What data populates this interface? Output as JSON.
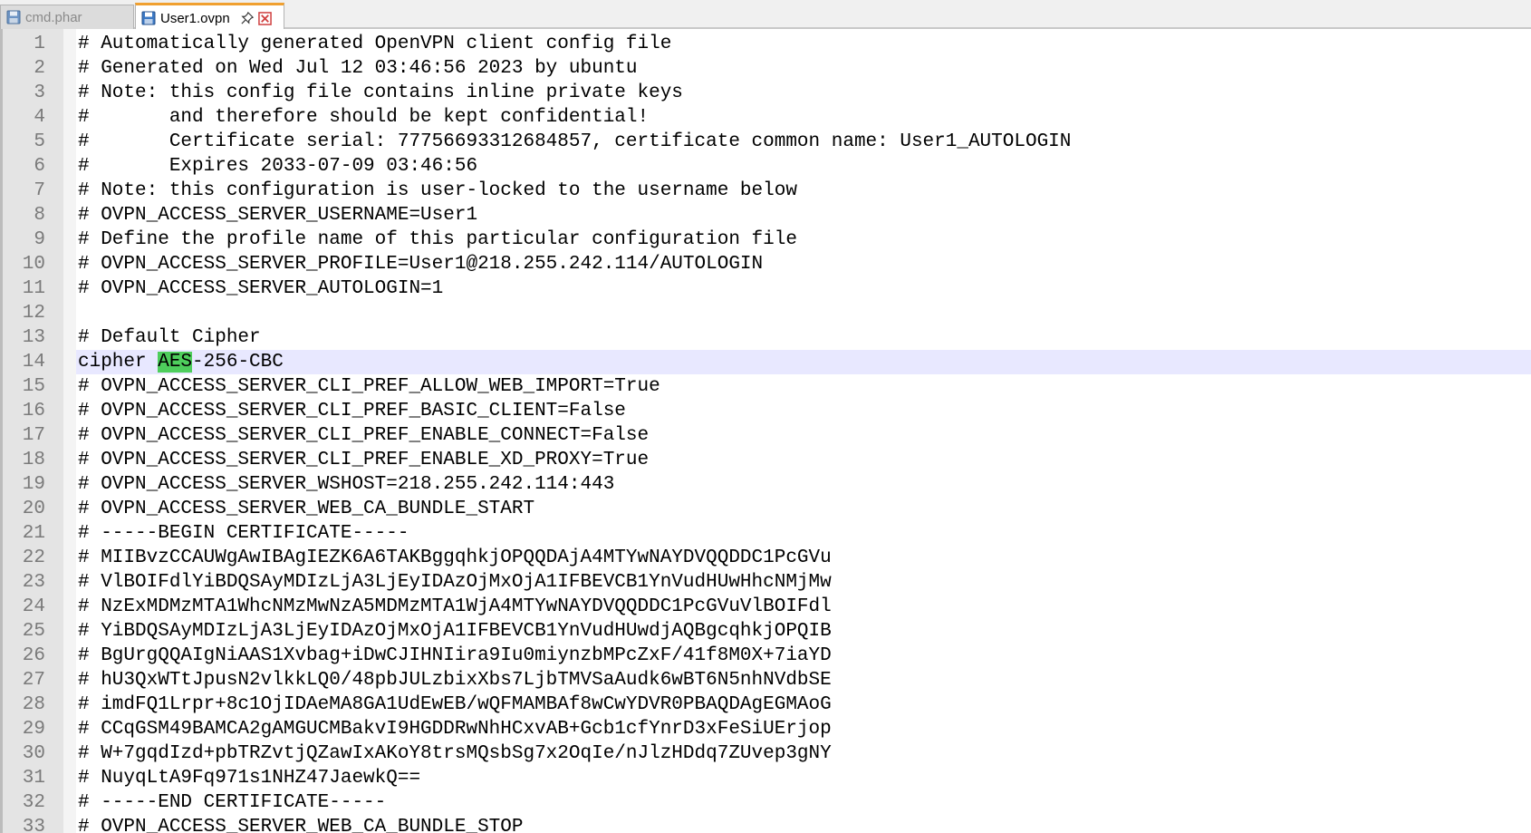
{
  "tabs": [
    {
      "label": "cmd.phar",
      "active": false
    },
    {
      "label": "User1.ovpn",
      "active": true
    }
  ],
  "icons": {
    "file": "save-disk-icon",
    "pin": "pin-icon",
    "close": "close-icon"
  },
  "colors": {
    "active_tab_accent": "#f0a030",
    "current_line": "#e8e8ff",
    "search_highlight": "#4ece5c",
    "close_icon": "#d04040"
  },
  "editor": {
    "current_line": 14,
    "highlight": {
      "line": 14,
      "text": "AES"
    },
    "lines": [
      {
        "n": "1",
        "text": "# Automatically generated OpenVPN client config file"
      },
      {
        "n": "2",
        "text": "# Generated on Wed Jul 12 03:46:56 2023 by ubuntu"
      },
      {
        "n": "3",
        "text": "# Note: this config file contains inline private keys"
      },
      {
        "n": "4",
        "text": "#       and therefore should be kept confidential!"
      },
      {
        "n": "5",
        "text": "#       Certificate serial: 77756693312684857, certificate common name: User1_AUTOLOGIN"
      },
      {
        "n": "6",
        "text": "#       Expires 2033-07-09 03:46:56"
      },
      {
        "n": "7",
        "text": "# Note: this configuration is user-locked to the username below"
      },
      {
        "n": "8",
        "text": "# OVPN_ACCESS_SERVER_USERNAME=User1"
      },
      {
        "n": "9",
        "text": "# Define the profile name of this particular configuration file"
      },
      {
        "n": "10",
        "text": "# OVPN_ACCESS_SERVER_PROFILE=User1@218.255.242.114/AUTOLOGIN"
      },
      {
        "n": "11",
        "text": "# OVPN_ACCESS_SERVER_AUTOLOGIN=1"
      },
      {
        "n": "12",
        "text": ""
      },
      {
        "n": "13",
        "text": "# Default Cipher"
      },
      {
        "n": "14",
        "pre": "cipher ",
        "hl": "AES",
        "post": "-256-CBC"
      },
      {
        "n": "15",
        "text": "# OVPN_ACCESS_SERVER_CLI_PREF_ALLOW_WEB_IMPORT=True"
      },
      {
        "n": "16",
        "text": "# OVPN_ACCESS_SERVER_CLI_PREF_BASIC_CLIENT=False"
      },
      {
        "n": "17",
        "text": "# OVPN_ACCESS_SERVER_CLI_PREF_ENABLE_CONNECT=False"
      },
      {
        "n": "18",
        "text": "# OVPN_ACCESS_SERVER_CLI_PREF_ENABLE_XD_PROXY=True"
      },
      {
        "n": "19",
        "text": "# OVPN_ACCESS_SERVER_WSHOST=218.255.242.114:443"
      },
      {
        "n": "20",
        "text": "# OVPN_ACCESS_SERVER_WEB_CA_BUNDLE_START"
      },
      {
        "n": "21",
        "text": "# -----BEGIN CERTIFICATE-----"
      },
      {
        "n": "22",
        "text": "# MIIBvzCCAUWgAwIBAgIEZK6A6TAKBggqhkjOPQQDAjA4MTYwNAYDVQQDDC1PcGVu"
      },
      {
        "n": "23",
        "text": "# VlBOIFdlYiBDQSAyMDIzLjA3LjEyIDAzOjMxOjA1IFBEVCB1YnVudHUwHhcNMjMw"
      },
      {
        "n": "24",
        "text": "# NzExMDMzMTA1WhcNMzMwNzA5MDMzMTA1WjA4MTYwNAYDVQQDDC1PcGVuVlBOIFdl"
      },
      {
        "n": "25",
        "text": "# YiBDQSAyMDIzLjA3LjEyIDAzOjMxOjA1IFBEVCB1YnVudHUwdjAQBgcqhkjOPQIB"
      },
      {
        "n": "26",
        "text": "# BgUrgQQAIgNiAAS1Xvbag+iDwCJIHNIira9Iu0miynzbMPcZxF/41f8M0X+7iaYD"
      },
      {
        "n": "27",
        "text": "# hU3QxWTtJpusN2vlkkLQ0/48pbJULzbixXbs7LjbTMVSaAudk6wBT6N5nhNVdbSE"
      },
      {
        "n": "28",
        "text": "# imdFQ1Lrpr+8c1OjIDAeMA8GA1UdEwEB/wQFMAMBAf8wCwYDVR0PBAQDAgEGMAoG"
      },
      {
        "n": "29",
        "text": "# CCqGSM49BAMCA2gAMGUCMBakvI9HGDDRwNhHCxvAB+Gcb1cfYnrD3xFeSiUErjop"
      },
      {
        "n": "30",
        "text": "# W+7gqdIzd+pbTRZvtjQZawIxAKoY8trsMQsbSg7x2OqIe/nJlzHDdq7ZUvep3gNY"
      },
      {
        "n": "31",
        "text": "# NuyqLtA9Fq971s1NHZ47JaewkQ=="
      },
      {
        "n": "32",
        "text": "# -----END CERTIFICATE-----"
      },
      {
        "n": "33",
        "text": "# OVPN_ACCESS_SERVER_WEB_CA_BUNDLE_STOP"
      }
    ]
  }
}
